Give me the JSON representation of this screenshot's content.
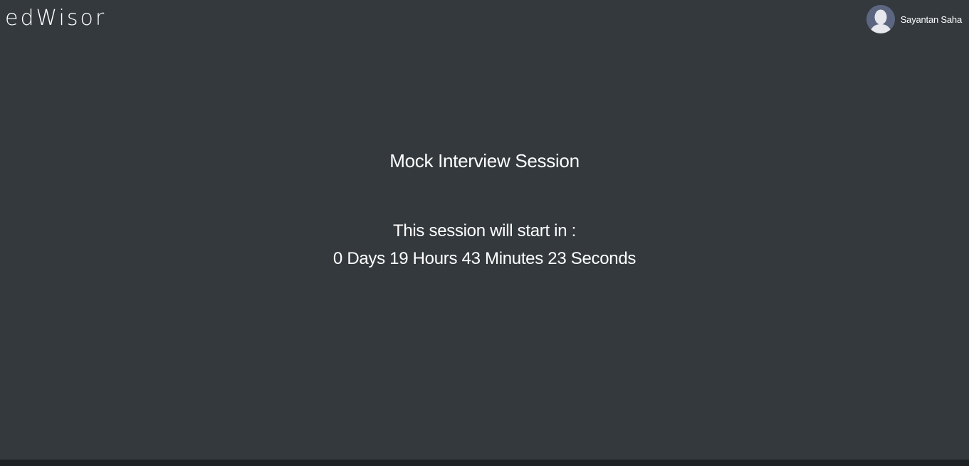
{
  "header": {
    "brand": "edWisor",
    "user_name": "Sayantan Saha",
    "avatar_icon": "user-avatar-icon"
  },
  "main": {
    "title": "Mock Interview Session",
    "subtitle": "This session will start in :",
    "countdown": "0 Days 19 Hours 43 Minutes 23 Seconds"
  },
  "colors": {
    "background": "#33393d",
    "text": "#ffffff",
    "avatar_bg": "#5c6680"
  }
}
